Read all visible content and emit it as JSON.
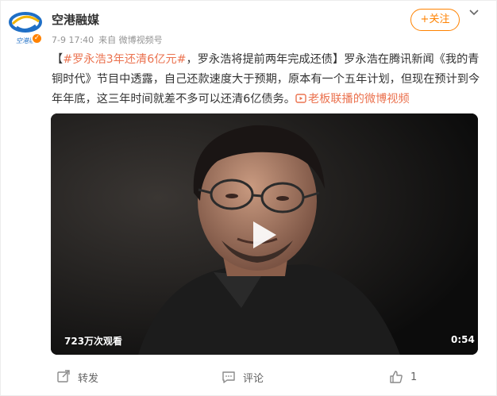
{
  "author": {
    "name": "空港融媒",
    "logo_text": "空港融"
  },
  "meta": {
    "time": "7-9 17:40",
    "source": "来自 微博视频号"
  },
  "follow_label": "+关注",
  "post": {
    "open_bracket": "【",
    "hashtag": "#罗永浩3年还清6亿元#",
    "headline": "，罗永浩将提前两年完成还债】",
    "body": "罗永浩在腾讯新闻《我的青铜时代》节目中透露，自己还款速度大于预期，原本有一个五年计划，但现在预计到今年年底，这三年时间就差不多可以还清6亿债务。",
    "link_text": "老板联播的微博视频"
  },
  "video": {
    "views": "723万次观看",
    "duration": "0:54"
  },
  "actions": {
    "repost": "转发",
    "comment": "评论",
    "like": "1"
  },
  "colors": {
    "accent": "#ff8200",
    "link": "#eb7350",
    "logo_blue": "#1f6fc6",
    "logo_yellow": "#f2b400"
  }
}
